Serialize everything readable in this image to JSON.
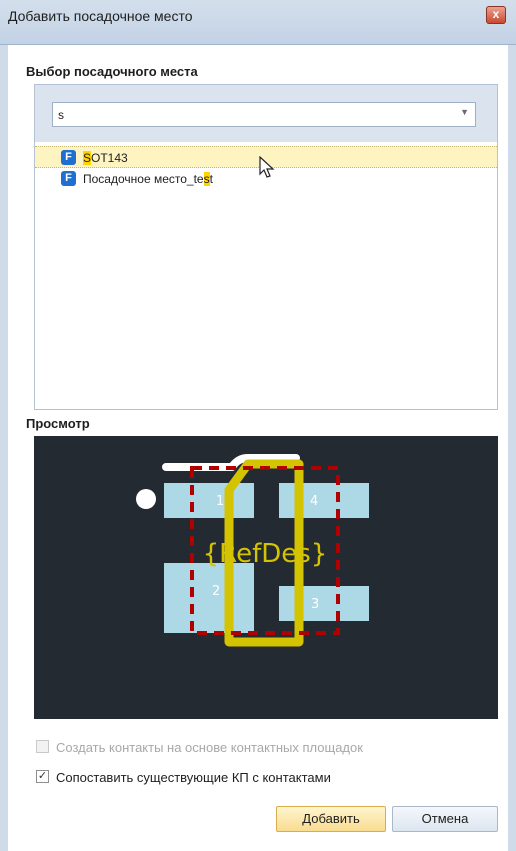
{
  "window": {
    "title": "Добавить посадочное место",
    "close_glyph": "x"
  },
  "selection": {
    "heading": "Выбор посадочного места",
    "search_value": "s",
    "items": [
      {
        "icon_letter": "F",
        "label_hl": "S",
        "label_rest": "OT143",
        "selected": true
      },
      {
        "icon_letter": "F",
        "label_pre": "Посадочное место_te",
        "label_hl": "s",
        "label_post": "t"
      }
    ]
  },
  "preview": {
    "heading": "Просмотр",
    "refdes": "{RefDes}",
    "pads": [
      "1",
      "2",
      "3",
      "4"
    ],
    "colors": {
      "background": "#242a31",
      "pad": "#add8e6",
      "outline": "#d4c300",
      "courtyard": "#b00000",
      "silk": "#ffffff"
    }
  },
  "options": {
    "create_contacts": {
      "label": "Создать контакты на основе контактных площадок",
      "checked": false,
      "enabled": false
    },
    "match_contacts": {
      "label": "Сопоставить существующие КП с контактами",
      "checked": true,
      "enabled": true
    }
  },
  "buttons": {
    "add": "Добавить",
    "cancel": "Отмена"
  }
}
